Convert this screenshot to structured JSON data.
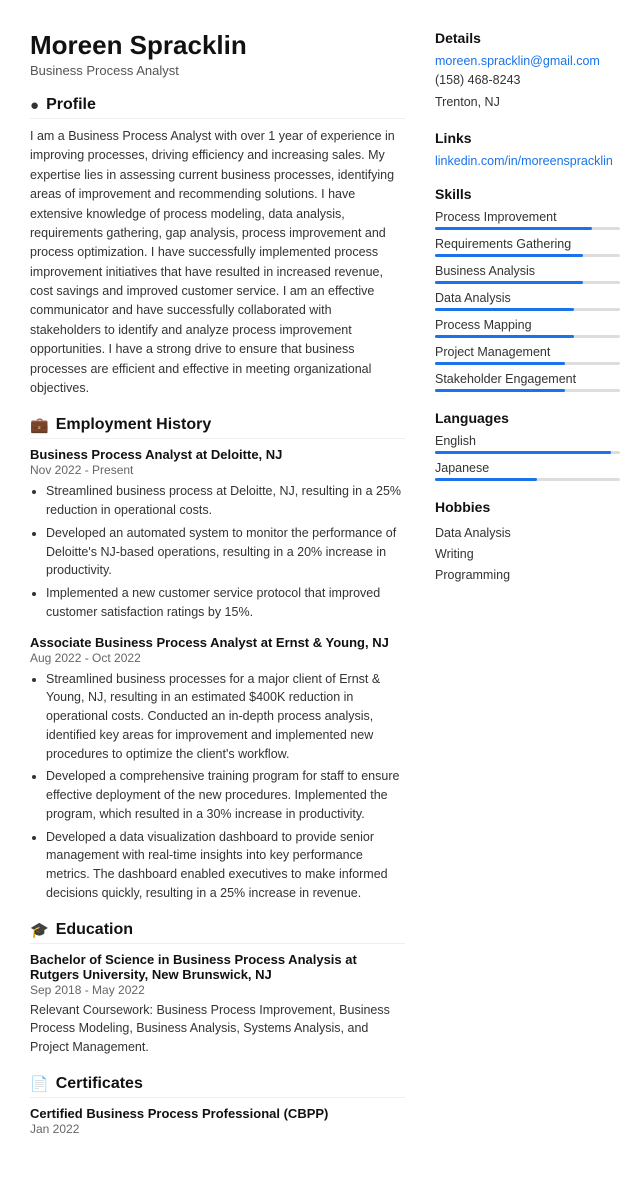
{
  "header": {
    "name": "Moreen Spracklin",
    "title": "Business Process Analyst"
  },
  "profile": {
    "section_label": "Profile",
    "text": "I am a Business Process Analyst with over 1 year of experience in improving processes, driving efficiency and increasing sales. My expertise lies in assessing current business processes, identifying areas of improvement and recommending solutions. I have extensive knowledge of process modeling, data analysis, requirements gathering, gap analysis, process improvement and process optimization. I have successfully implemented process improvement initiatives that have resulted in increased revenue, cost savings and improved customer service. I am an effective communicator and have successfully collaborated with stakeholders to identify and analyze process improvement opportunities. I have a strong drive to ensure that business processes are efficient and effective in meeting organizational objectives."
  },
  "employment": {
    "section_label": "Employment History",
    "jobs": [
      {
        "title": "Business Process Analyst at Deloitte, NJ",
        "dates": "Nov 2022 - Present",
        "bullets": [
          "Streamlined business process at Deloitte, NJ, resulting in a 25% reduction in operational costs.",
          "Developed an automated system to monitor the performance of Deloitte's NJ-based operations, resulting in a 20% increase in productivity.",
          "Implemented a new customer service protocol that improved customer satisfaction ratings by 15%."
        ]
      },
      {
        "title": "Associate Business Process Analyst at Ernst & Young, NJ",
        "dates": "Aug 2022 - Oct 2022",
        "bullets": [
          "Streamlined business processes for a major client of Ernst & Young, NJ, resulting in an estimated $400K reduction in operational costs. Conducted an in-depth process analysis, identified key areas for improvement and implemented new procedures to optimize the client's workflow.",
          "Developed a comprehensive training program for staff to ensure effective deployment of the new procedures. Implemented the program, which resulted in a 30% increase in productivity.",
          "Developed a data visualization dashboard to provide senior management with real-time insights into key performance metrics. The dashboard enabled executives to make informed decisions quickly, resulting in a 25% increase in revenue."
        ]
      }
    ]
  },
  "education": {
    "section_label": "Education",
    "items": [
      {
        "title": "Bachelor of Science in Business Process Analysis at Rutgers University, New Brunswick, NJ",
        "dates": "Sep 2018 - May 2022",
        "text": "Relevant Coursework: Business Process Improvement, Business Process Modeling, Business Analysis, Systems Analysis, and Project Management."
      }
    ]
  },
  "certificates": {
    "section_label": "Certificates",
    "items": [
      {
        "title": "Certified Business Process Professional (CBPP)",
        "dates": "Jan 2022"
      }
    ]
  },
  "details": {
    "section_label": "Details",
    "email": "moreen.spracklin@gmail.com",
    "phone": "(158) 468-8243",
    "location": "Trenton, NJ"
  },
  "links": {
    "section_label": "Links",
    "linkedin": "linkedin.com/in/moreenspracklin"
  },
  "skills": {
    "section_label": "Skills",
    "items": [
      {
        "label": "Process Improvement",
        "pct": 85
      },
      {
        "label": "Requirements Gathering",
        "pct": 80
      },
      {
        "label": "Business Analysis",
        "pct": 80
      },
      {
        "label": "Data Analysis",
        "pct": 75
      },
      {
        "label": "Process Mapping",
        "pct": 75
      },
      {
        "label": "Project Management",
        "pct": 70
      },
      {
        "label": "Stakeholder Engagement",
        "pct": 70
      }
    ]
  },
  "languages": {
    "section_label": "Languages",
    "items": [
      {
        "label": "English",
        "pct": 95
      },
      {
        "label": "Japanese",
        "pct": 55
      }
    ]
  },
  "hobbies": {
    "section_label": "Hobbies",
    "items": [
      "Data Analysis",
      "Writing",
      "Programming"
    ]
  }
}
